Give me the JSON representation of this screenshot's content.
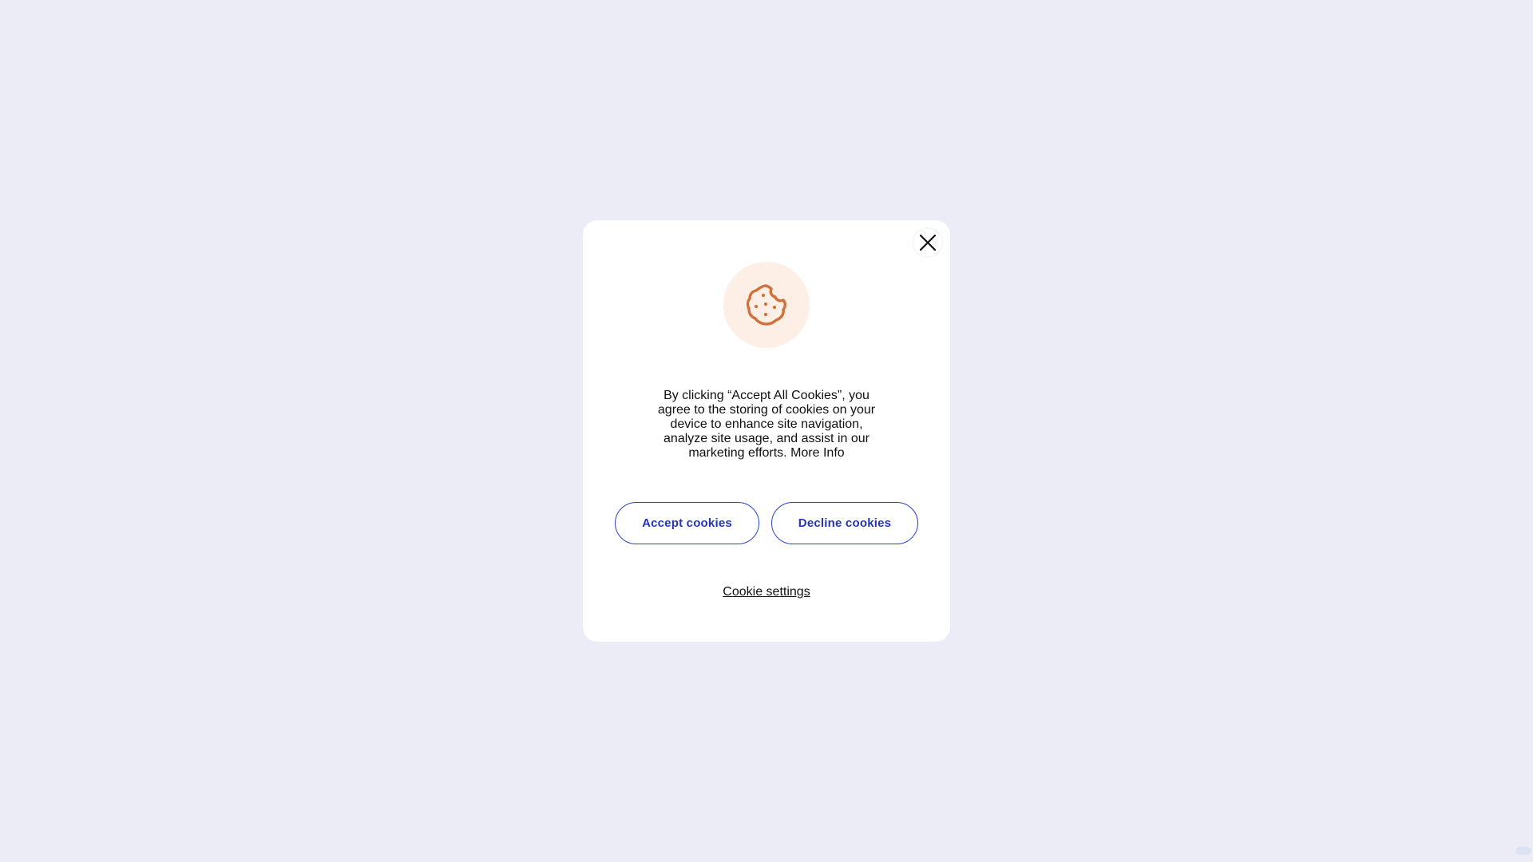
{
  "dialog": {
    "message": "By clicking “Accept All Cookies”, you agree to the storing of cookies on your device to enhance site navigation, analyze site usage, and assist in our marketing efforts.",
    "more_info_label": "More Info",
    "accept_label": "Accept cookies",
    "decline_label": "Decline cookies",
    "settings_label": "Cookie settings",
    "close_icon": "close-icon",
    "cookie_icon": "cookie-icon"
  },
  "colors": {
    "page_background": "#ebecf6",
    "dialog_background": "#ffffff",
    "cookie_icon": "#d2703a",
    "cookie_badge": "#fdeee6",
    "button_accent": "#2b45c9"
  }
}
